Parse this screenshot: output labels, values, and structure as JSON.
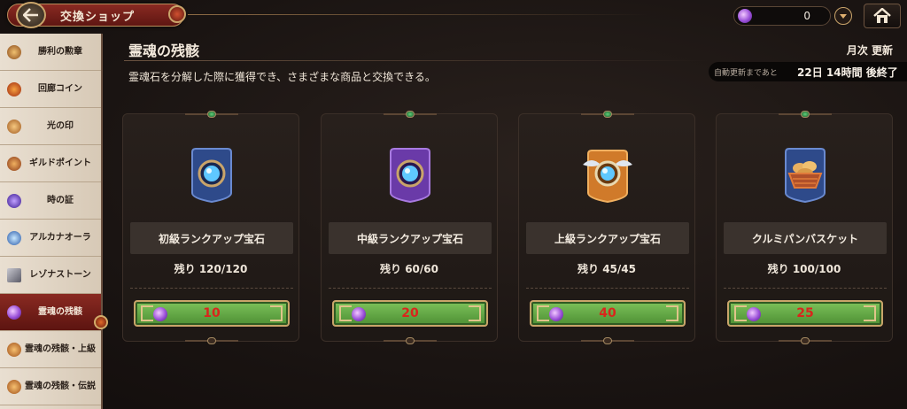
{
  "topbar": {
    "title": "交換ショップ",
    "currency_value": "0"
  },
  "sidebar": {
    "items": [
      {
        "label": "勝利の勲章",
        "icon": "medal-icon",
        "color": "#c47a2c"
      },
      {
        "label": "回廊コイン",
        "icon": "coin-icon",
        "color": "#d0541f"
      },
      {
        "label": "光の印",
        "icon": "light-seal-icon",
        "color": "#d4822c"
      },
      {
        "label": "ギルドポイント",
        "icon": "guild-point-icon",
        "color": "#c46a2a"
      },
      {
        "label": "時の証",
        "icon": "time-proof-icon",
        "color": "#6a3ad0"
      },
      {
        "label": "アルカナオーラ",
        "icon": "arcana-aura-icon",
        "color": "#4a8ad8"
      },
      {
        "label": "レゾナストーン",
        "icon": "resona-stone-icon",
        "color": "#7a7a86"
      },
      {
        "label": "霊魂の残骸",
        "icon": "soul-remnant-icon",
        "color": "#9a4fd8",
        "active": true
      },
      {
        "label": "霊魂の残骸・上級",
        "icon": "soul-remnant-advanced-icon",
        "color": "#d0782c"
      },
      {
        "label": "霊魂の残骸・伝説",
        "icon": "soul-remnant-legend-icon",
        "color": "#d0782c"
      }
    ]
  },
  "header": {
    "title": "霊魂の残骸",
    "subtitle": "霊魂石を分解した際に獲得でき、さまざまな商品と交換できる。",
    "monthly": "月次 更新",
    "refresh_label": "自動更新まであと",
    "refresh_time": "22日 14時間 後終了"
  },
  "cards": [
    {
      "name": "初級ランクアップ宝石",
      "remain": "残り 120/120",
      "price": "10",
      "icon": "blue-rank-gem-icon",
      "frame": "#2e4a8a"
    },
    {
      "name": "中級ランクアップ宝石",
      "remain": "残り 60/60",
      "price": "20",
      "icon": "purple-rank-gem-icon",
      "frame": "#6a3aa8"
    },
    {
      "name": "上級ランクアップ宝石",
      "remain": "残り 45/45",
      "price": "40",
      "icon": "winged-rank-gem-icon",
      "frame": "#d07a2a"
    },
    {
      "name": "クルミパンバスケット",
      "remain": "残り 100/100",
      "price": "25",
      "icon": "bread-basket-icon",
      "frame": "#2e4a8a"
    }
  ]
}
